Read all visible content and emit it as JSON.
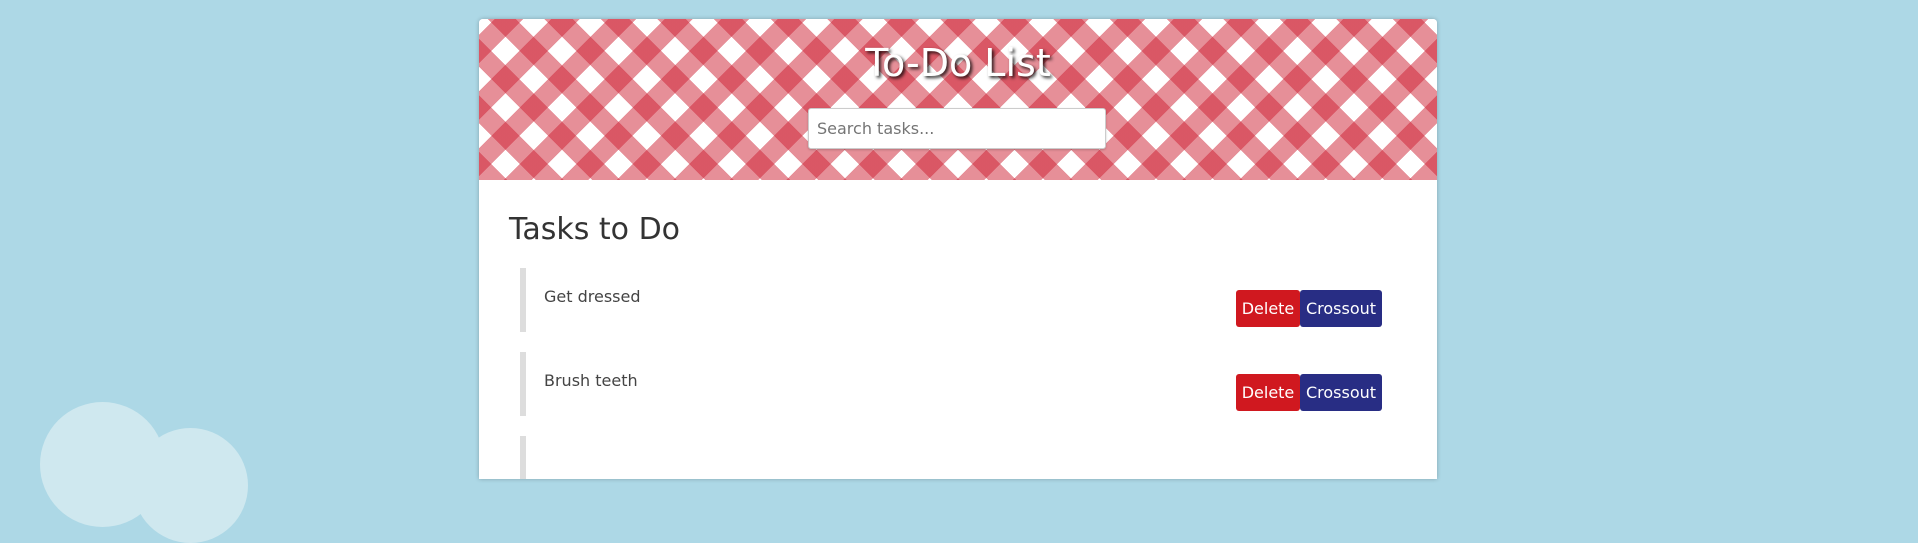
{
  "header": {
    "title": "To-Do List",
    "search_placeholder": "Search tasks..."
  },
  "section": {
    "title": "Tasks to Do"
  },
  "tasks": [
    {
      "text": "Get dressed",
      "delete_label": "Delete",
      "crossout_label": "Crossout"
    },
    {
      "text": "Brush teeth",
      "delete_label": "Delete",
      "crossout_label": "Crossout"
    }
  ],
  "colors": {
    "background": "#add8e6",
    "checker": "#cd2032",
    "delete_button": "#d0181f",
    "crossout_button": "#282d84"
  }
}
